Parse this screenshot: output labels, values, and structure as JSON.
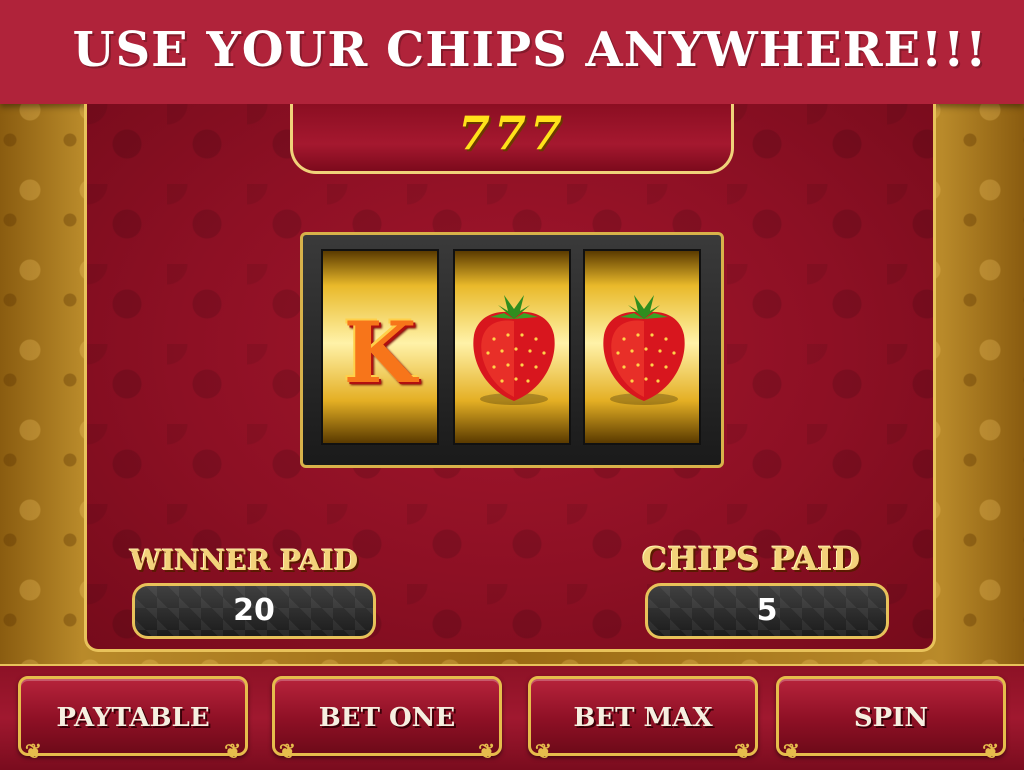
{
  "banner": {
    "text": "USE YOUR CHIPS ANYWHERE!!!"
  },
  "machine": {
    "title": "777"
  },
  "reels": [
    {
      "symbol": "K"
    },
    {
      "symbol": "strawberry-icon"
    },
    {
      "symbol": "strawberry-icon"
    }
  ],
  "stats": {
    "winner_paid_label": "WINNER PAID",
    "winner_paid_value": "20",
    "chips_paid_label": "CHIPS PAID",
    "chips_paid_value": "5"
  },
  "buttons": {
    "paytable": "PAYTABLE",
    "bet_one": "BET ONE",
    "bet_max": "BET MAX",
    "spin": "SPIN"
  },
  "colors": {
    "banner": "#b0233a",
    "panel": "#8d1024",
    "gold": "#e8c25a",
    "title": "#ffe21a"
  }
}
